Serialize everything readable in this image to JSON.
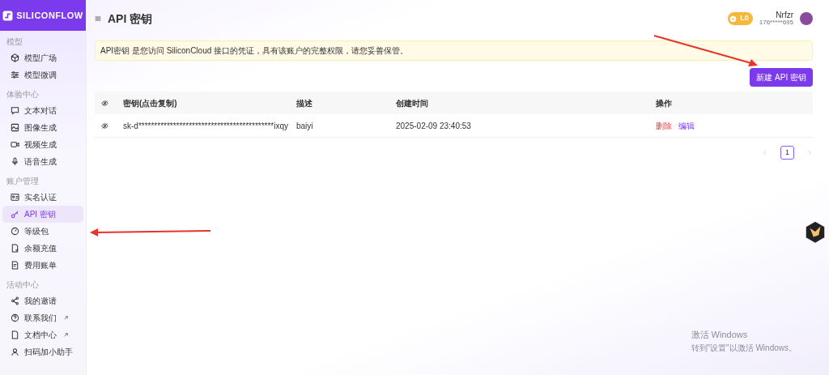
{
  "brand": {
    "name": "SILICONFLOW"
  },
  "sidebar": {
    "sections": [
      {
        "title": "模型",
        "items": [
          {
            "label": "模型广场",
            "selected": false
          },
          {
            "label": "模型微调",
            "selected": false
          }
        ]
      },
      {
        "title": "体验中心",
        "items": [
          {
            "label": "文本对话",
            "selected": false
          },
          {
            "label": "图像生成",
            "selected": false
          },
          {
            "label": "视频生成",
            "selected": false
          },
          {
            "label": "语音生成",
            "selected": false
          }
        ]
      },
      {
        "title": "账户管理",
        "items": [
          {
            "label": "实名认证",
            "selected": false
          },
          {
            "label": "API 密钥",
            "selected": true
          },
          {
            "label": "等级包",
            "selected": false
          },
          {
            "label": "余额充值",
            "selected": false
          },
          {
            "label": "费用账单",
            "selected": false
          }
        ]
      },
      {
        "title": "活动中心",
        "items": [
          {
            "label": "我的邀请",
            "selected": false,
            "external": false
          },
          {
            "label": "联系我们",
            "selected": false,
            "external": true
          },
          {
            "label": "文档中心",
            "selected": false,
            "external": true
          },
          {
            "label": "扫码加小助手",
            "selected": false,
            "external": false
          }
        ]
      }
    ]
  },
  "header": {
    "title": "API 密钥",
    "level_badge": "L0",
    "user": {
      "name": "Nrfzr",
      "phone": "176*****695"
    }
  },
  "notice": "API密钥 是您访问 SiliconCloud 接口的凭证，具有该账户的完整权限，请您妥善保管。",
  "create_button": "新建 API 密钥",
  "table": {
    "columns": [
      "密钥(点击复制)",
      "描述",
      "创建时间",
      "操作"
    ],
    "rows": [
      {
        "key": "sk-d*******************************************ixqy",
        "description": "baiyi",
        "created": "2025-02-09 23:40:53",
        "actions": [
          {
            "label": "删除",
            "kind": "danger"
          },
          {
            "label": "编辑",
            "kind": "edit"
          }
        ]
      }
    ]
  },
  "pagination": {
    "pages": [
      {
        "label": "1",
        "selected": true
      }
    ]
  },
  "os_notice": {
    "title": "激活 Windows",
    "text": "转到\"设置\"以激活 Windows。"
  }
}
